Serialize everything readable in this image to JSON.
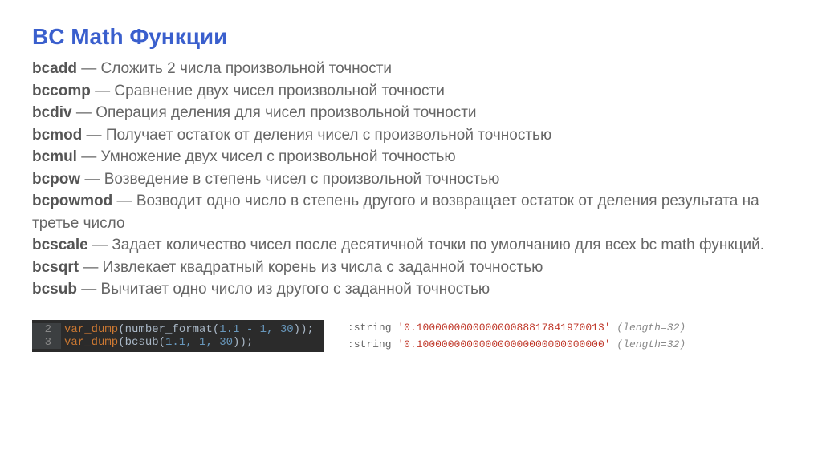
{
  "title": "BC Math Функции",
  "functions": [
    {
      "name": "bcadd",
      "desc": "Сложить 2 числа произвольной точности"
    },
    {
      "name": "bccomp",
      "desc": "Сравнение двух чисел произвольной точности"
    },
    {
      "name": "bcdiv",
      "desc": "Операция деления для чисел произвольной точности"
    },
    {
      "name": "bcmod",
      "desc": "Получает остаток от деления чисел с произвольной точностью"
    },
    {
      "name": "bcmul",
      "desc": "Умножение двух чисел с произвольной точностью"
    },
    {
      "name": "bcpow",
      "desc": "Возведение в степень чисел с произвольной точностью"
    },
    {
      "name": "bcpowmod",
      "desc": "Возводит одно число в степень другого и возвращает остаток от деления результата на третье число"
    },
    {
      "name": "bcscale",
      "desc": "Задает количество чисел после десятичной точки по умолчанию для всех bc math функций."
    },
    {
      "name": "bcsqrt",
      "desc": "Извлекает квадратный корень из числа с заданной точностью"
    },
    {
      "name": "bcsub",
      "desc": "Вычитает одно число из другого с заданной точностью"
    }
  ],
  "code": {
    "lines": [
      {
        "num": "2",
        "text_a": "var_dump",
        "text_b": "(number_format(",
        "args": "1.1 - 1, 30",
        "text_c": "));"
      },
      {
        "num": "3",
        "text_a": "var_dump",
        "text_b": "(bcsub(",
        "args": "1.1, 1, 30",
        "text_c": "));"
      }
    ]
  },
  "output": [
    {
      "type": ":string",
      "value": "'0.100000000000000088817841970013'",
      "len": "(length=32)"
    },
    {
      "type": ":string",
      "value": "'0.100000000000000000000000000000'",
      "len": "(length=32)"
    }
  ]
}
